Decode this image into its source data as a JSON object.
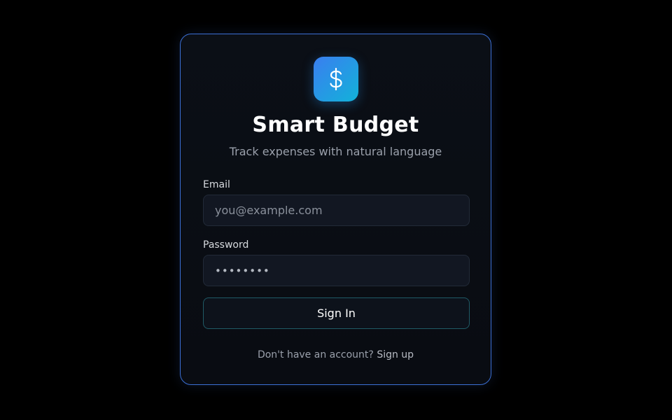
{
  "app": {
    "title": "Smart Budget",
    "subtitle": "Track expenses with natural language",
    "logo_icon": "dollar-icon",
    "accent_colors": [
      "#3a7ef0",
      "#12b2d9"
    ]
  },
  "form": {
    "email_label": "Email",
    "email_placeholder": "you@example.com",
    "email_value": "",
    "password_label": "Password",
    "password_value": "••••••••",
    "submit_label": "Sign In"
  },
  "footer": {
    "prompt": "Don't have an account?",
    "link_label": "Sign up"
  }
}
